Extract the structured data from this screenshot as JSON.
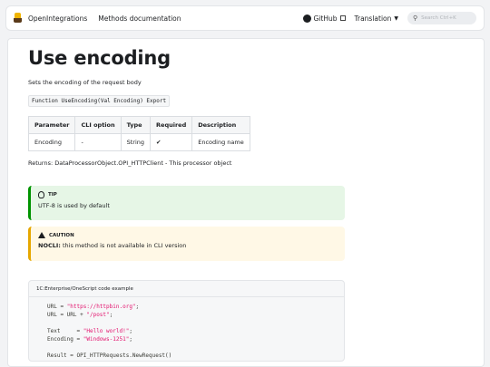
{
  "nav": {
    "brand": "OpenIntegrations",
    "methods": "Methods documentation",
    "github": "GitHub",
    "translation": "Translation",
    "search_placeholder": "Search Ctrl+K"
  },
  "page": {
    "title": "Use encoding",
    "description": "Sets the encoding of the request body",
    "signature": "Function UseEncoding(Val Encoding) Export",
    "table": {
      "headers": [
        "Parameter",
        "CLI option",
        "Type",
        "Required",
        "Description"
      ],
      "rows": [
        [
          "Encoding",
          "-",
          "String",
          "✔",
          "Encoding name"
        ]
      ]
    },
    "returns": "Returns: DataProcessorObject.OPI_HTTPClient - This processor object"
  },
  "tip": {
    "title": "TIP",
    "text": "UTF-8 is used by default"
  },
  "caution": {
    "title": "CAUTION",
    "label": "NOCLI:",
    "text": "this method is not available in CLI version"
  },
  "code": {
    "title": "1C:Enterprise/OneScript code example",
    "lines": [
      {
        "pre": "URL = ",
        "str": "\"https://httpbin.org\"",
        "post": ";"
      },
      {
        "pre": "URL = URL + ",
        "str": "\"/post\"",
        "post": ";"
      },
      {
        "pre": "",
        "str": "",
        "post": ""
      },
      {
        "pre": "Text     = ",
        "str": "\"Hello world!\"",
        "post": ";"
      },
      {
        "pre": "Encoding = ",
        "str": "\"Windows-1251\"",
        "post": ";"
      },
      {
        "pre": "",
        "str": "",
        "post": ""
      },
      {
        "pre": "Result = OPI_HTTPRequests.NewRequest()",
        "str": "",
        "post": ""
      }
    ]
  }
}
